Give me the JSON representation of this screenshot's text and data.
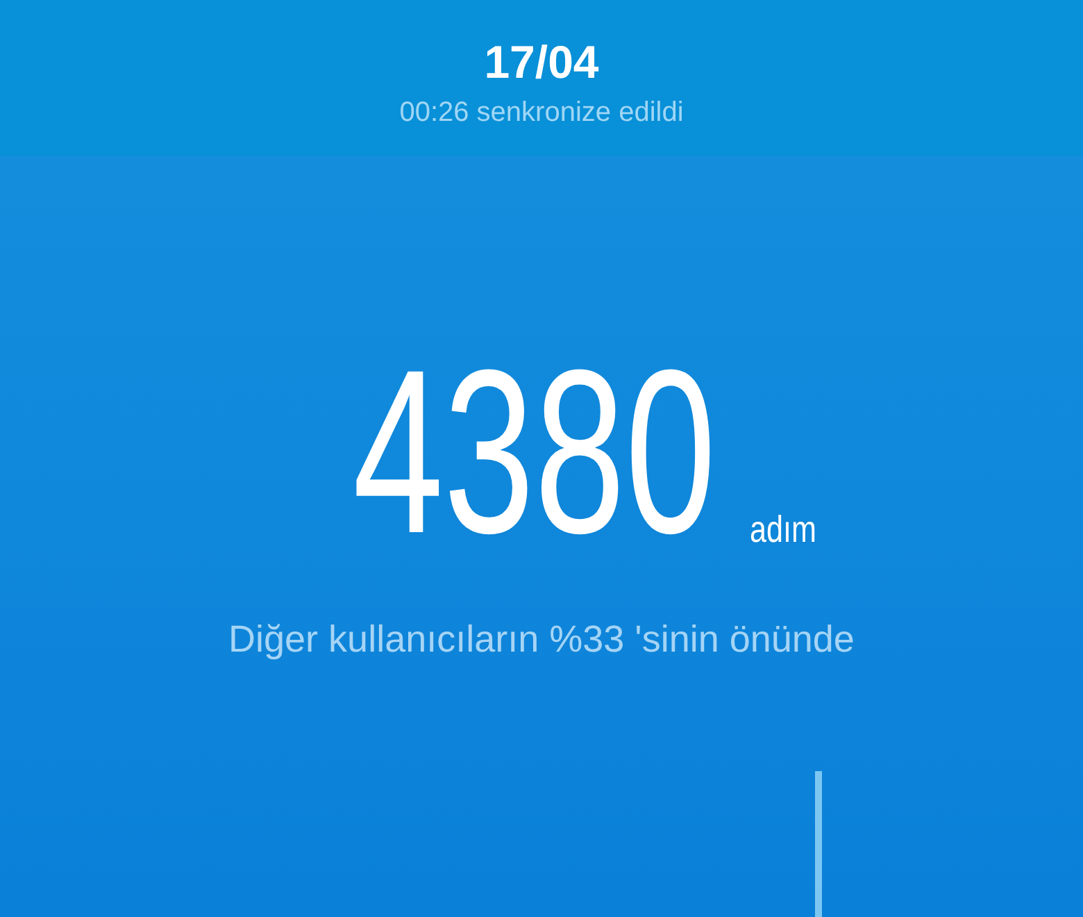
{
  "header": {
    "date": "17/04",
    "sync_status": "00:26 senkronize edildi"
  },
  "steps": {
    "count": "4380",
    "unit": "adım",
    "comparison": "Diğer kullanıcıların %33 'sinin önünde"
  }
}
